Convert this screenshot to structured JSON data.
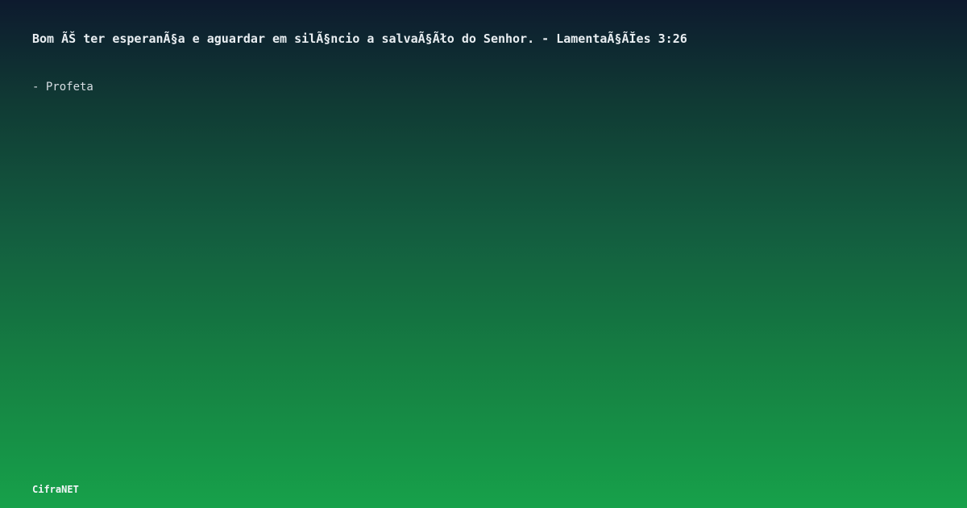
{
  "quote": {
    "text": "Bom ÃŠ ter esperanÃ§a e aguardar em silÃ§ncio a salvaÃ§Ãło do Senhor. - LamentaÃ§ÃĬes 3:26"
  },
  "author": {
    "text": "- Profeta"
  },
  "brand": {
    "name": "CifraNET"
  },
  "colors": {
    "gradient_top": "#0d1a2e",
    "gradient_bottom": "#17a14a",
    "text": "#e9eef2"
  }
}
